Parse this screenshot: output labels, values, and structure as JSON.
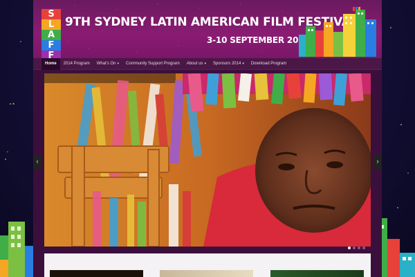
{
  "header": {
    "logo_letters": [
      "S",
      "L",
      "A",
      "F",
      "F"
    ],
    "logo_colors": [
      "#e8413a",
      "#f5a623",
      "#3fae49",
      "#2a7de1",
      "#9b2fae"
    ],
    "title": "9TH SYDNEY LATIN AMERICAN FILM FESTIVAL",
    "dates": "3-10 SEPTEMBER 2014"
  },
  "nav": {
    "items": [
      {
        "label": "Home",
        "active": true,
        "dropdown": false
      },
      {
        "label": "2014 Program",
        "active": false,
        "dropdown": false
      },
      {
        "label": "What's On",
        "active": false,
        "dropdown": true
      },
      {
        "label": "Community Support Program",
        "active": false,
        "dropdown": false
      },
      {
        "label": "About us",
        "active": false,
        "dropdown": true
      },
      {
        "label": "Sponsors 2014",
        "active": false,
        "dropdown": true
      },
      {
        "label": "Download Program",
        "active": false,
        "dropdown": false
      }
    ],
    "caret_icon": "▾"
  },
  "slider": {
    "prev_icon": "chevron-left-icon",
    "next_icon": "chevron-right-icon",
    "prev_glyph": "‹",
    "next_glyph": "›",
    "slide_count": 4,
    "active_slide": 1
  },
  "colors": {
    "accent": "#8a1c72",
    "nav_bg": "#4a1746",
    "nav_active": "#2a0a28"
  }
}
